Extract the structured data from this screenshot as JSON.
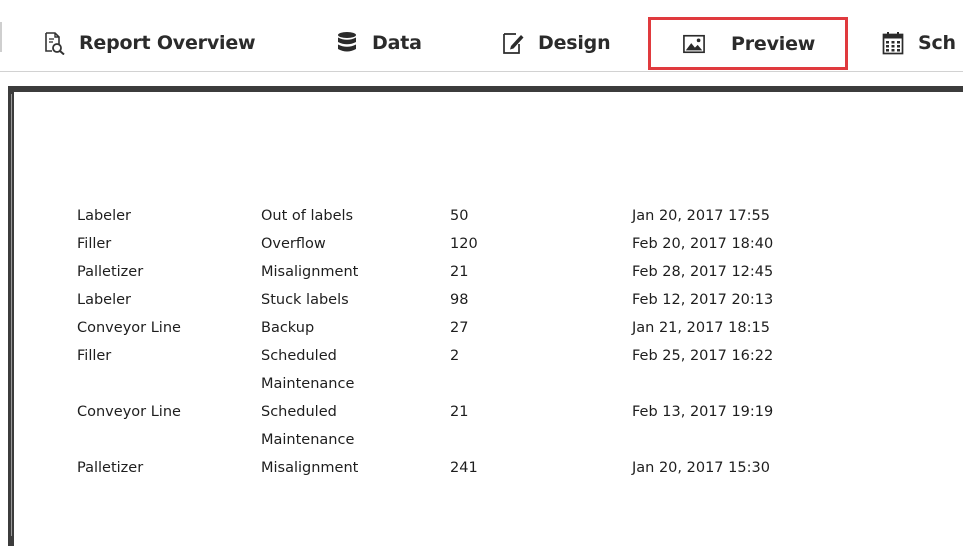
{
  "tabs": {
    "report_overview": "Report Overview",
    "data": "Data",
    "design": "Design",
    "preview": "Preview",
    "schedule_partial": "Sch"
  },
  "colors": {
    "active_tab_border": "#e03a3e",
    "tab_text": "#2b2b2b",
    "frame_border": "#3c3c3c"
  },
  "report": {
    "rows": [
      {
        "machine": "Labeler",
        "reason": "Out of labels",
        "reason2": "",
        "count": "50",
        "timestamp": "Jan 20, 2017 17:55"
      },
      {
        "machine": "Filler",
        "reason": "Overflow",
        "reason2": "",
        "count": "120",
        "timestamp": "Feb 20, 2017 18:40"
      },
      {
        "machine": "Palletizer",
        "reason": "Misalignment",
        "reason2": "",
        "count": "21",
        "timestamp": "Feb 28, 2017 12:45"
      },
      {
        "machine": "Labeler",
        "reason": "Stuck labels",
        "reason2": "",
        "count": "98",
        "timestamp": "Feb 12, 2017 20:13"
      },
      {
        "machine": "Conveyor Line",
        "reason": "Backup",
        "reason2": "",
        "count": "27",
        "timestamp": "Jan 21, 2017 18:15"
      },
      {
        "machine": "Filler",
        "reason": "Scheduled",
        "reason2": "Maintenance",
        "count": "2",
        "timestamp": "Feb 25, 2017 16:22"
      },
      {
        "machine": "Conveyor Line",
        "reason": "Scheduled",
        "reason2": "Maintenance",
        "count": "21",
        "timestamp": "Feb 13, 2017 19:19"
      },
      {
        "machine": "Palletizer",
        "reason": "Misalignment",
        "reason2": "",
        "count": "241",
        "timestamp": "Jan 20, 2017 15:30"
      }
    ]
  }
}
